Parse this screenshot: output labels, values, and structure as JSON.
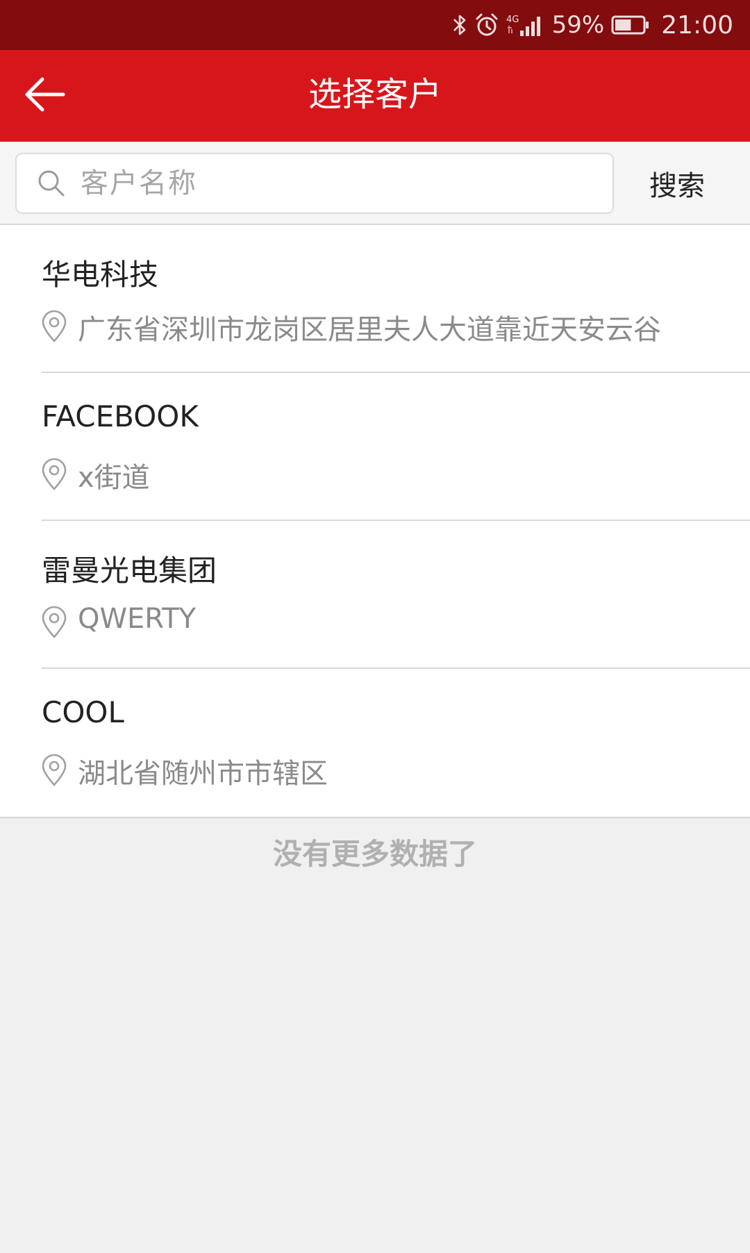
{
  "status_bar": {
    "network": "4G",
    "battery_percent": "59%",
    "battery_level": 0.59,
    "time": "21:00",
    "icons": [
      "bluetooth-icon",
      "alarm-icon",
      "signal-icon",
      "battery-icon"
    ]
  },
  "app_bar": {
    "title": "选择客户",
    "back_icon": "arrow-left-icon"
  },
  "search": {
    "placeholder": "客户名称",
    "value": "",
    "button_label": "搜索"
  },
  "customers": [
    {
      "name": "华电科技",
      "address": "广东省深圳市龙岗区居里夫人大道靠近天安云谷"
    },
    {
      "name": "FACEBOOK",
      "address": "x街道"
    },
    {
      "name": "雷曼光电集团",
      "address": "QWERTY"
    },
    {
      "name": "COOL",
      "address": "湖北省随州市市辖区"
    }
  ],
  "footer": {
    "no_more_text": "没有更多数据了"
  },
  "colors": {
    "status_bar": "#820c0e",
    "app_bar": "#d7161b",
    "background": "#f0f0f0"
  }
}
